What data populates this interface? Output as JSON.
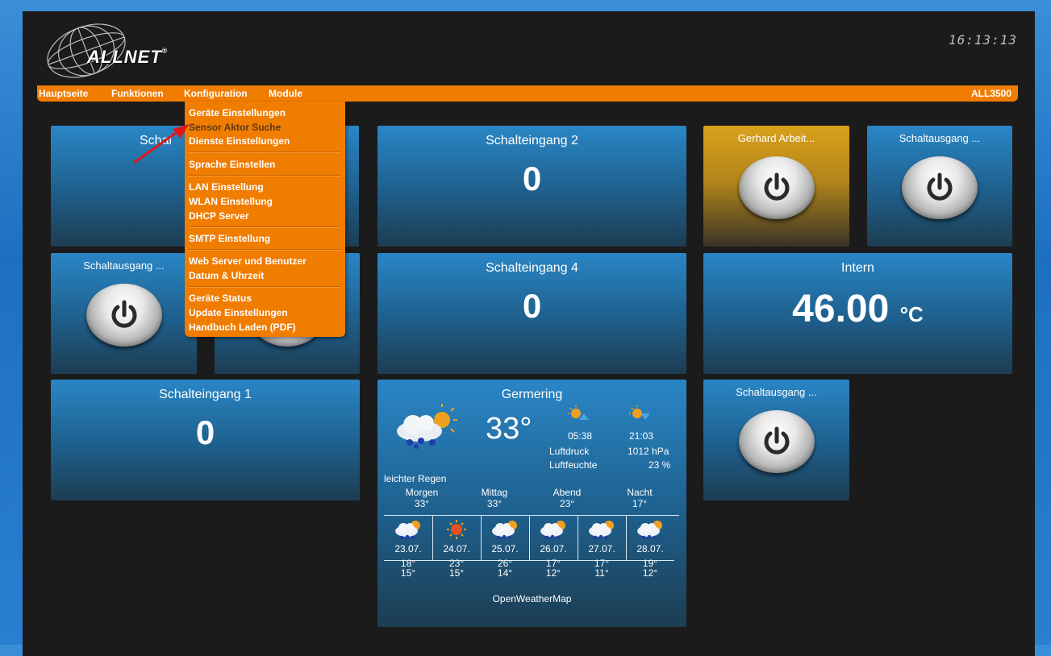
{
  "header": {
    "brand": "ALLNET",
    "brand_mark": "®",
    "clock": "16:13:13",
    "menu": [
      "Hauptseite",
      "Funktionen",
      "Konfiguration",
      "Module"
    ],
    "model": "ALL3500"
  },
  "dropdown": {
    "groups": [
      [
        "Geräte Einstellungen",
        "Sensor Aktor Suche",
        "Dienste Einstellungen"
      ],
      [
        "Sprache Einstellen"
      ],
      [
        "LAN Einstellung",
        "WLAN Einstellung",
        "DHCP Server"
      ],
      [
        "SMTP Einstellung"
      ],
      [
        "Web Server und Benutzer",
        "Datum & Uhrzeit"
      ],
      [
        "Geräte Status",
        "Update Einstellungen",
        "Handbuch Laden (PDF)"
      ]
    ],
    "highlighted": "Sensor Aktor Suche"
  },
  "tiles": {
    "t1_title": "Schal",
    "schalteingang2": {
      "title": "Schalteingang 2",
      "value": "0"
    },
    "gerhard": {
      "title": "Gerhard Arbeit..."
    },
    "schaltausgang_a": {
      "title": "Schaltausgang ..."
    },
    "schaltausgang_b": {
      "title": "Schaltausgang ..."
    },
    "schalteingang4": {
      "title": "Schalteingang 4",
      "value": "0"
    },
    "intern": {
      "title": "Intern",
      "value": "46.00",
      "unit": "°C"
    },
    "schalteingang1": {
      "title": "Schalteingang 1",
      "value": "0"
    },
    "schaltausgang_c": {
      "title": "Schaltausgang ..."
    }
  },
  "weather": {
    "city": "Germering",
    "temp": "33°",
    "sunrise": "05:38",
    "sunset": "21:03",
    "pressure_label": "Luftdruck",
    "pressure": "1012 hPa",
    "humidity_label": "Luftfeuchte",
    "humidity": "23 %",
    "condition": "leichter Regen",
    "periods": [
      {
        "label": "Morgen",
        "temp": "33°"
      },
      {
        "label": "Mittag",
        "temp": "33°"
      },
      {
        "label": "Abend",
        "temp": "23°"
      },
      {
        "label": "Nacht",
        "temp": "17°"
      }
    ],
    "forecast": [
      {
        "date": "23.07.",
        "high": "18°",
        "low": "15°",
        "icon": "rain-cloud-sun-icon"
      },
      {
        "date": "24.07.",
        "high": "23°",
        "low": "15°",
        "icon": "sun-icon"
      },
      {
        "date": "25.07.",
        "high": "26°",
        "low": "14°",
        "icon": "rain-cloud-sun-icon"
      },
      {
        "date": "26.07.",
        "high": "17°",
        "low": "12°",
        "icon": "rain-cloud-sun-icon"
      },
      {
        "date": "27.07.",
        "high": "17°",
        "low": "11°",
        "icon": "rain-cloud-sun-icon"
      },
      {
        "date": "28.07.",
        "high": "19°",
        "low": "12°",
        "icon": "rain-cloud-sun-icon"
      }
    ],
    "source": "OpenWeatherMap"
  },
  "colors": {
    "accent": "#f07c00",
    "tile_blue": "#2a86c6",
    "tile_gold": "#d9a21c"
  }
}
